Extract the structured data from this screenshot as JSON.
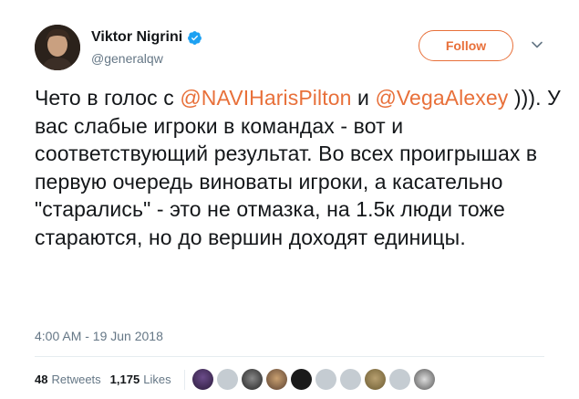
{
  "author": {
    "display_name": "Viktor Nigrini",
    "handle": "@generalqw",
    "verified": true
  },
  "follow_button": {
    "label": "Follow"
  },
  "tweet": {
    "segments": [
      {
        "text": "Чето в голос с ",
        "type": "text"
      },
      {
        "text": "@NAVIHarisPilton",
        "type": "mention"
      },
      {
        "text": "  и ",
        "type": "text"
      },
      {
        "text": "@VegaAlexey",
        "type": "mention"
      },
      {
        "text": " ))). У вас слабые игроки в командах - вот и соответствующий результат. Во всех проигрышах в первую очередь виноваты игроки, а касательно \"старались\" - это не отмазка, на 1.5к люди тоже стараются, но до вершин доходят единицы.",
        "type": "text"
      }
    ],
    "timestamp": "4:00 AM - 19 Jun 2018"
  },
  "stats": {
    "retweets_count": "48",
    "retweets_label": "Retweets",
    "likes_count": "1,175",
    "likes_label": "Likes"
  },
  "likers": [
    "photo1",
    "gray",
    "photo2",
    "photo3",
    "dark",
    "gray",
    "gray",
    "photo4",
    "gray",
    "photo5"
  ],
  "colors": {
    "accent": "#e8703a",
    "text": "#14171a",
    "secondary": "#657786",
    "verified": "#1da1f2"
  }
}
